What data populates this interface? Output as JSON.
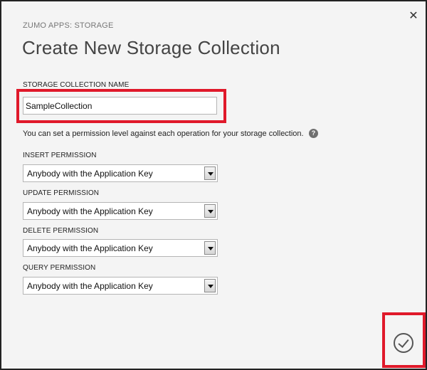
{
  "dialog": {
    "subtitle": "ZUMO APPS: STORAGE",
    "title": "Create New Storage Collection",
    "close_icon": "close-icon",
    "confirm_icon": "checkmark-icon"
  },
  "name_field": {
    "label": "STORAGE COLLECTION NAME",
    "value": "SampleCollection"
  },
  "info": {
    "text": "You can set a permission level against each operation for your storage collection.",
    "icon": "help-icon"
  },
  "permissions": [
    {
      "label": "INSERT PERMISSION",
      "value": "Anybody with the Application Key"
    },
    {
      "label": "UPDATE PERMISSION",
      "value": "Anybody with the Application Key"
    },
    {
      "label": "DELETE PERMISSION",
      "value": "Anybody with the Application Key"
    },
    {
      "label": "QUERY PERMISSION",
      "value": "Anybody with the Application Key"
    }
  ],
  "colors": {
    "highlight": "#e0192a",
    "dialog_background": "#f4f4f4"
  }
}
